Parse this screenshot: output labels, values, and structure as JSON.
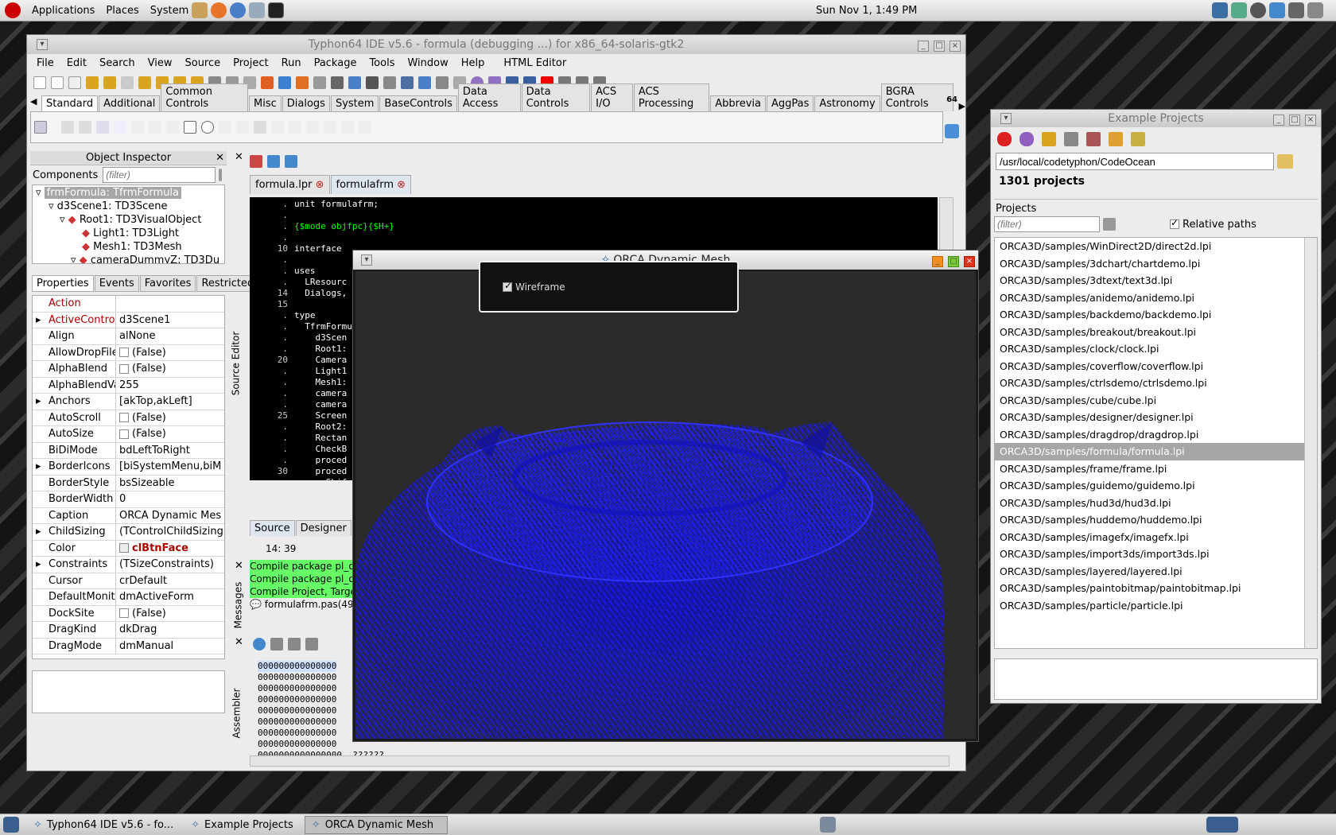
{
  "top_panel": {
    "menus": [
      "Applications",
      "Places",
      "System"
    ],
    "clock": "Sun Nov  1,  1:49 PM"
  },
  "ide": {
    "title": "Typhon64 IDE v5.6 - formula (debugging ...) for x86_64-solaris-gtk2",
    "menu": [
      "File",
      "Edit",
      "Search",
      "View",
      "Source",
      "Project",
      "Run",
      "Package",
      "Tools",
      "Window",
      "Help",
      "HTML Editor"
    ],
    "palette_tabs": [
      "Standard",
      "Additional",
      "Common Controls",
      "Misc",
      "Dialogs",
      "System",
      "BaseControls",
      "Data Access",
      "Data Controls",
      "ACS I/O",
      "ACS Processing",
      "Abbrevia",
      "AggPas",
      "Astronomy",
      "BGRA Controls"
    ],
    "badge": "64"
  },
  "inspector": {
    "title": "Object Inspector",
    "components_label": "Components",
    "filter_placeholder": "(filter)",
    "tree": [
      "frmFormula: TfrmFormula",
      "d3Scene1: TD3Scene",
      "Root1: TD3VisualObject",
      "Light1: TD3Light",
      "Mesh1: TD3Mesh",
      "cameraDummyZ: TD3Du"
    ],
    "tabs": [
      "Properties",
      "Events",
      "Favorites",
      "Restricted"
    ],
    "props": [
      {
        "n": "Action",
        "v": ""
      },
      {
        "n": "ActiveControl",
        "v": "d3Scene1"
      },
      {
        "n": "Align",
        "v": "alNone"
      },
      {
        "n": "AllowDropFiles",
        "v": "(False)"
      },
      {
        "n": "AlphaBlend",
        "v": "(False)"
      },
      {
        "n": "AlphaBlendValu",
        "v": "255"
      },
      {
        "n": "Anchors",
        "v": "[akTop,akLeft]"
      },
      {
        "n": "AutoScroll",
        "v": "(False)"
      },
      {
        "n": "AutoSize",
        "v": "(False)"
      },
      {
        "n": "BiDiMode",
        "v": "bdLeftToRight"
      },
      {
        "n": "BorderIcons",
        "v": "[biSystemMenu,biM"
      },
      {
        "n": "BorderStyle",
        "v": "bsSizeable"
      },
      {
        "n": "BorderWidth",
        "v": "0"
      },
      {
        "n": "Caption",
        "v": "ORCA Dynamic Mes"
      },
      {
        "n": "ChildSizing",
        "v": "(TControlChildSizing"
      },
      {
        "n": "Color",
        "v": "clBtnFace"
      },
      {
        "n": "Constraints",
        "v": "(TSizeConstraints)"
      },
      {
        "n": "Cursor",
        "v": "crDefault"
      },
      {
        "n": "DefaultMonitor",
        "v": "dmActiveForm"
      },
      {
        "n": "DockSite",
        "v": "(False)"
      },
      {
        "n": "DragKind",
        "v": "dkDrag"
      },
      {
        "n": "DragMode",
        "v": "dmManual"
      }
    ]
  },
  "editor": {
    "tabs": [
      "formula.lpr",
      "formulafrm"
    ],
    "side_label": "Source Editor",
    "lines": [
      {
        "ln": ".",
        "t": "unit formulafrm;"
      },
      {
        "ln": ".",
        "t": ""
      },
      {
        "ln": ".",
        "t": "{$mode objfpc}{$H+}",
        "g": true
      },
      {
        "ln": ".",
        "t": ""
      },
      {
        "ln": "10",
        "t": "interface"
      },
      {
        "ln": ".",
        "t": ""
      },
      {
        "ln": ".",
        "t": "uses"
      },
      {
        "ln": ".",
        "t": "  LResourc"
      },
      {
        "ln": "14",
        "t": "  Dialogs,"
      },
      {
        "ln": "15",
        "t": ""
      },
      {
        "ln": ".",
        "t": "type"
      },
      {
        "ln": ".",
        "t": "  TfrmFormu"
      },
      {
        "ln": ".",
        "t": "    d3Scen"
      },
      {
        "ln": ".",
        "t": "    Root1:"
      },
      {
        "ln": "20",
        "t": "    Camera"
      },
      {
        "ln": ".",
        "t": "    Light1"
      },
      {
        "ln": ".",
        "t": "    Mesh1:"
      },
      {
        "ln": ".",
        "t": "    camera"
      },
      {
        "ln": ".",
        "t": "    camera"
      },
      {
        "ln": "25",
        "t": "    Screen"
      },
      {
        "ln": ".",
        "t": "    Root2:"
      },
      {
        "ln": ".",
        "t": "    Rectan"
      },
      {
        "ln": ".",
        "t": "    CheckB"
      },
      {
        "ln": ".",
        "t": "    proced"
      },
      {
        "ln": "30",
        "t": "    proced"
      },
      {
        "ln": ".",
        "t": "      Shif"
      }
    ],
    "bottom_tabs": [
      "Source",
      "Designer"
    ],
    "cursor_pos": "14:  39"
  },
  "messages": {
    "label": "Messages",
    "items": [
      "Compile package pl_or",
      "Compile package pl_or",
      "Compile Project, Targe",
      "formulafrm.pas(49,"
    ]
  },
  "assembler": {
    "label": "Assembler",
    "rows": [
      "000000000000000",
      "000000000000000",
      "000000000000000",
      "000000000000000",
      "000000000000000",
      "000000000000000",
      "000000000000000",
      "000000000000000"
    ],
    "last": "0000000000000000  ??????"
  },
  "orca": {
    "title": "ORCA Dynamic Mesh",
    "checkbox": "Wireframe"
  },
  "projects": {
    "title": "Example Projects",
    "path": "/usr/local/codetyphon/CodeOcean",
    "count": "1301 projects",
    "section": "Projects",
    "filter_placeholder": "(filter)",
    "relative": "Relative paths",
    "items": [
      "ORCA3D/samples/WinDirect2D/direct2d.lpi",
      "ORCA3D/samples/3dchart/chartdemo.lpi",
      "ORCA3D/samples/3dtext/text3d.lpi",
      "ORCA3D/samples/anidemo/anidemo.lpi",
      "ORCA3D/samples/backdemo/backdemo.lpi",
      "ORCA3D/samples/breakout/breakout.lpi",
      "ORCA3D/samples/clock/clock.lpi",
      "ORCA3D/samples/coverflow/coverflow.lpi",
      "ORCA3D/samples/ctrlsdemo/ctrlsdemo.lpi",
      "ORCA3D/samples/cube/cube.lpi",
      "ORCA3D/samples/designer/designer.lpi",
      "ORCA3D/samples/dragdrop/dragdrop.lpi",
      "ORCA3D/samples/formula/formula.lpi",
      "ORCA3D/samples/frame/frame.lpi",
      "ORCA3D/samples/guidemo/guidemo.lpi",
      "ORCA3D/samples/hud3d/hud3d.lpi",
      "ORCA3D/samples/huddemo/huddemo.lpi",
      "ORCA3D/samples/imagefx/imagefx.lpi",
      "ORCA3D/samples/import3ds/import3ds.lpi",
      "ORCA3D/samples/layered/layered.lpi",
      "ORCA3D/samples/paintobitmap/paintobitmap.lpi",
      "ORCA3D/samples/particle/particle.lpi"
    ],
    "selected_index": 12
  },
  "taskbar": [
    "Typhon64 IDE v5.6 - fo...",
    "Example Projects",
    "ORCA Dynamic Mesh"
  ]
}
